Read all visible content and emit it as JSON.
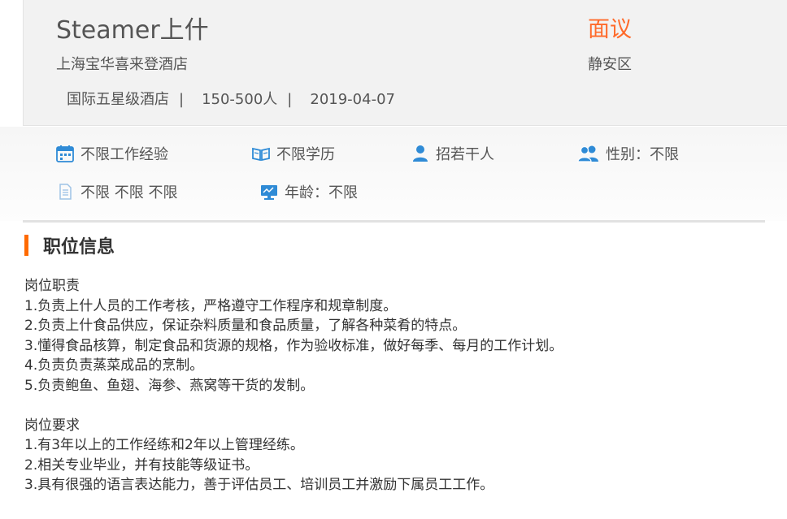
{
  "job": {
    "title": "Steamer上什",
    "company": "上海宝华喜来登酒店",
    "salary": "面议",
    "district": "静安区",
    "meta": {
      "hotel_type": "国际五星级酒店",
      "size": "150-500人",
      "date": "2019-04-07",
      "separator": "|"
    }
  },
  "requirements": {
    "experience": {
      "label": "不限工作经验",
      "icon": "calendar-icon"
    },
    "education": {
      "label": "不限学历",
      "icon": "book-icon"
    },
    "headcount": {
      "label": "招若干人",
      "icon": "person-icon"
    },
    "gender": {
      "label": "性别：不限",
      "icon": "people-icon"
    },
    "other": {
      "label": "不限 不限 不限",
      "icon": "document-icon"
    },
    "age": {
      "label": "年龄：不限",
      "icon": "monitor-icon"
    }
  },
  "section": {
    "title": "职位信息"
  },
  "description": {
    "duties_heading": "岗位职责",
    "duties": [
      "1.负责上什人员的工作考核，严格遵守工作程序和规章制度。",
      "2.负责上什食品供应，保证杂料质量和食品质量，了解各种菜肴的特点。",
      "3.懂得食品核算，制定食品和货源的规格，作为验收标准，做好每季、每月的工作计划。",
      "4.负责负责蒸菜成品的烹制。",
      "5.负责鲍鱼、鱼翅、海参、燕窝等干货的发制。"
    ],
    "requirements_heading": "岗位要求",
    "requirements": [
      "1.有3年以上的工作经练和2年以上管理经练。",
      "2.相关专业毕业，并有技能等级证书。",
      "3.具有很强的语言表达能力，善于评估员工、培训员工并激励下属员工工作。"
    ]
  },
  "colors": {
    "accent": "#ff6a00",
    "salary": "#ff6a2a",
    "icon_blue": "#2f8bd6"
  }
}
